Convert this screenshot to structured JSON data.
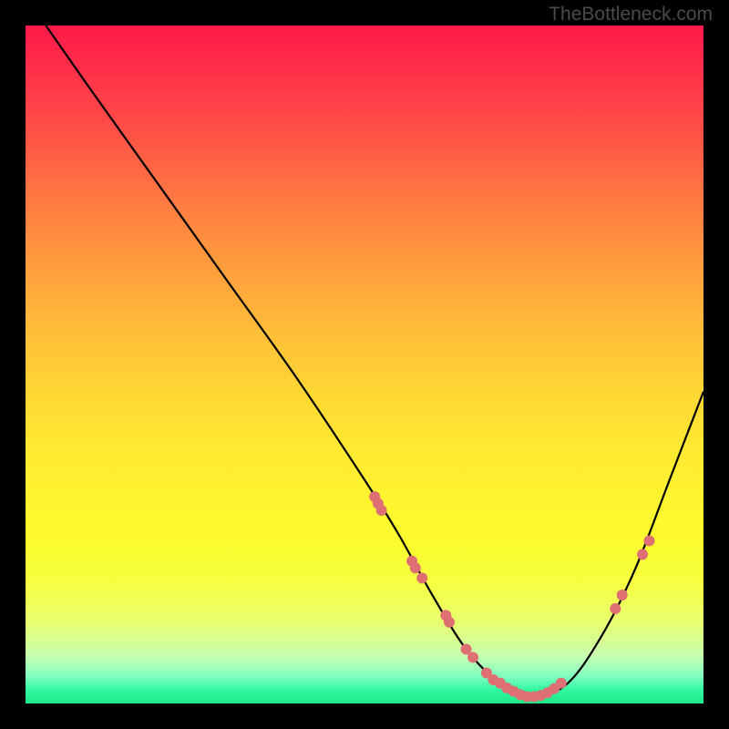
{
  "watermark": "TheBottleneck.com",
  "chart_data": {
    "type": "line",
    "title": "",
    "xlabel": "",
    "ylabel": "",
    "xlim": [
      0,
      100
    ],
    "ylim": [
      0,
      100
    ],
    "curve": {
      "x": [
        3,
        10,
        20,
        30,
        40,
        50,
        55,
        60,
        65,
        70,
        75,
        80,
        85,
        90,
        95,
        100
      ],
      "y": [
        100,
        90,
        76,
        62,
        48,
        33,
        25,
        16,
        8,
        3,
        1,
        3,
        10,
        20,
        33,
        46
      ]
    },
    "markers": {
      "x": [
        51.5,
        52,
        52.5,
        57,
        57.5,
        58.5,
        62,
        62.5,
        65,
        66,
        68,
        69,
        70,
        71,
        72,
        73,
        74,
        75,
        76,
        77,
        78,
        79,
        87,
        88,
        91,
        92
      ],
      "y": [
        30.5,
        29.5,
        28.5,
        21,
        20,
        18.5,
        13,
        12,
        8,
        6.8,
        4.5,
        3.5,
        3,
        2.3,
        1.8,
        1.3,
        1,
        1,
        1.2,
        1.6,
        2.2,
        3,
        14,
        16,
        22,
        24
      ],
      "color": "#de6f73",
      "size": 6
    },
    "gradient_stops": [
      {
        "pos": 0.0,
        "color": "#ff1a4a"
      },
      {
        "pos": 0.5,
        "color": "#ffd030"
      },
      {
        "pos": 0.95,
        "color": "#c0ffb0"
      },
      {
        "pos": 1.0,
        "color": "#20e888"
      }
    ]
  }
}
